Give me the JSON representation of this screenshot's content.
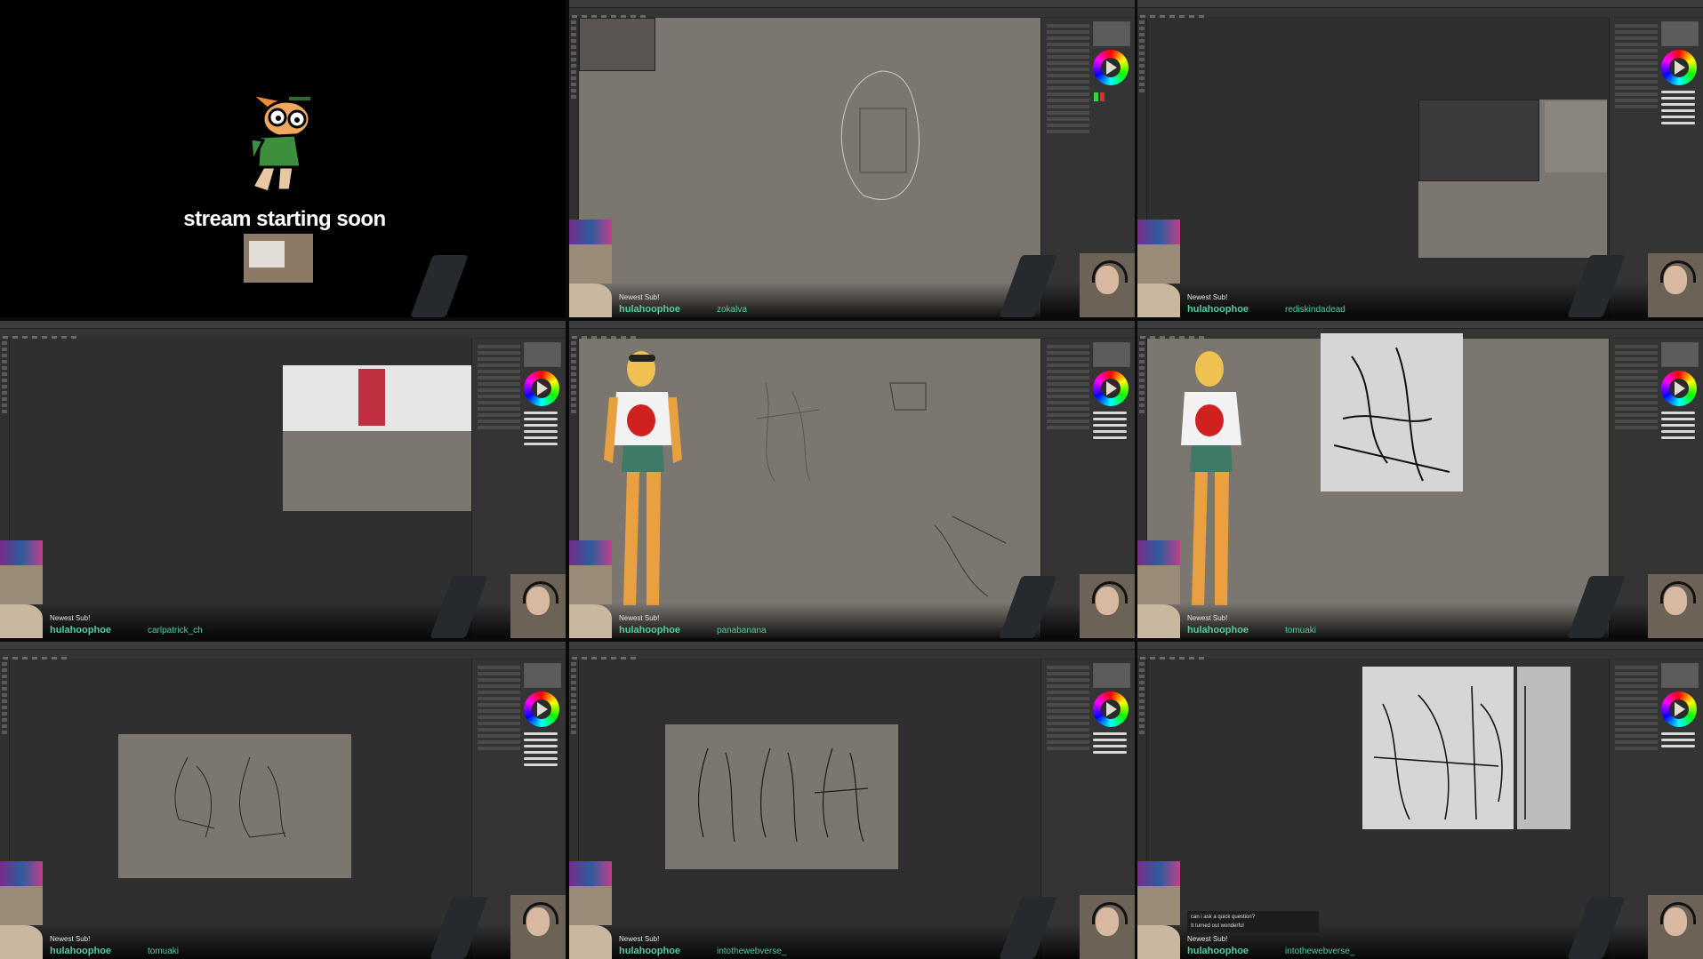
{
  "overlay": {
    "newest_sub_label": "Newest Sub!",
    "newest_sub_name": "hulahoophoe"
  },
  "tiles": [
    {
      "type": "start",
      "title": "stream starting soon",
      "follower": ""
    },
    {
      "type": "canvas",
      "follower": "zokalva"
    },
    {
      "type": "canvas",
      "follower": "rediskindadead"
    },
    {
      "type": "canvas",
      "follower": "carlpatrick_ch"
    },
    {
      "type": "canvas",
      "follower": "panabanana"
    },
    {
      "type": "canvas",
      "follower": "tomuaki"
    },
    {
      "type": "canvas",
      "follower": "tomuaki"
    },
    {
      "type": "canvas",
      "follower": "intothewebverse_"
    },
    {
      "type": "canvas",
      "follower": "intothewebverse_"
    }
  ],
  "chat": {
    "messages": [
      "can i ask a quick question?",
      "It turned out wonderful"
    ]
  },
  "colors": {
    "accent_green": "#4fcf9f",
    "canvas_gray": "#7b7670",
    "app_dark": "#2e2e2e"
  },
  "icons": [
    "color-wheel-icon",
    "brush-icon",
    "gun-icon",
    "mascot-icon"
  ]
}
